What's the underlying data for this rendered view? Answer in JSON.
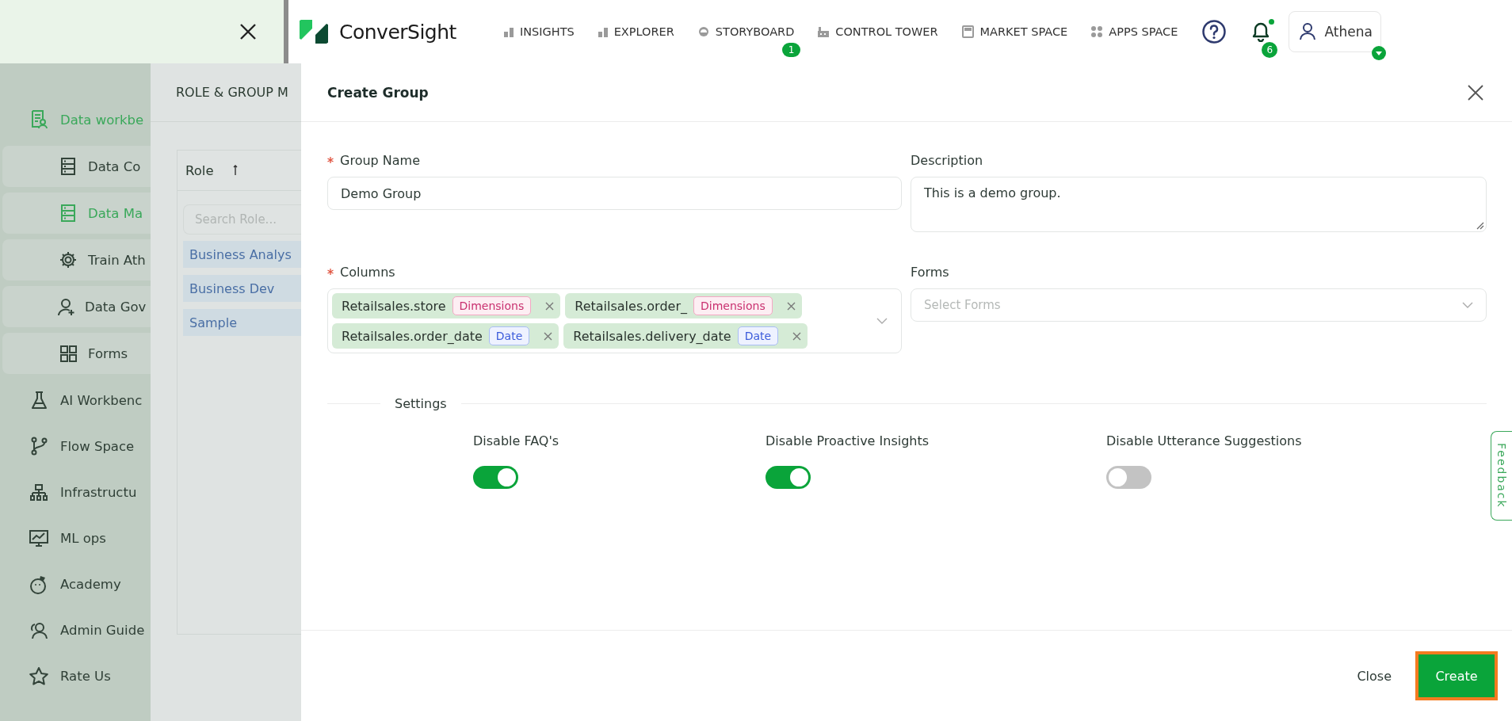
{
  "topbar": {
    "logo": "ConverSight",
    "nav": [
      {
        "label": "INSIGHTS",
        "kind": "bars"
      },
      {
        "label": "EXPLORER",
        "kind": "bars"
      },
      {
        "label": "STORYBOARD",
        "kind": "gauge",
        "badge": "1"
      },
      {
        "label": "CONTROL TOWER",
        "kind": "tower"
      },
      {
        "label": "MARKET SPACE",
        "kind": "store"
      },
      {
        "label": "APPS SPACE",
        "kind": "dots"
      }
    ],
    "notifications": {
      "count": "6",
      "unread": true
    },
    "user": {
      "name": "Athena"
    }
  },
  "sidebar": {
    "items": [
      {
        "label": "Data workbe",
        "kind": "doc",
        "active": true,
        "children": [
          {
            "label": "Data Co",
            "kind": "db",
            "active": false
          },
          {
            "label": "Data Ma",
            "kind": "db",
            "active": true
          },
          {
            "label": "Train Ath",
            "kind": "gear",
            "active": false
          },
          {
            "label": "Data Gov",
            "kind": "user-plus",
            "active": false
          },
          {
            "label": "Forms",
            "kind": "grid",
            "active": false
          }
        ]
      },
      {
        "label": "AI Workbenc",
        "kind": "flask",
        "active": false
      },
      {
        "label": "Flow Space",
        "kind": "branch",
        "active": false
      },
      {
        "label": "Infrastructu",
        "kind": "tree",
        "active": false
      },
      {
        "label": "ML ops",
        "kind": "chart",
        "active": false
      },
      {
        "label": "Academy",
        "kind": "face",
        "active": false
      },
      {
        "label": "Admin Guide",
        "kind": "users",
        "active": false
      },
      {
        "label": "Rate Us",
        "kind": "star",
        "active": false
      }
    ]
  },
  "role_panel": {
    "title": "ROLE & GROUP M",
    "column": "Role",
    "search": {
      "placeholder": "Search Role..."
    },
    "rows": [
      "Business Analys",
      "Business Dev",
      "Sample"
    ]
  },
  "modal": {
    "title": "Create Group",
    "group_name": {
      "label": "Group Name",
      "required": true,
      "value": "Demo Group"
    },
    "description": {
      "label": "Description",
      "required": false,
      "value": "This is a demo group."
    },
    "columns": {
      "label": "Columns",
      "required": true,
      "tags": [
        {
          "name": "Retailsales.store",
          "type": "Dimensions",
          "kind": "dimension"
        },
        {
          "name": "Retailsales.order_",
          "type": "Dimensions",
          "kind": "dimension"
        },
        {
          "name": "Retailsales.order_date",
          "type": "Date",
          "kind": "date"
        },
        {
          "name": "Retailsales.delivery_date",
          "type": "Date",
          "kind": "date"
        }
      ]
    },
    "forms": {
      "label": "Forms",
      "required": false,
      "placeholder": "Select Forms"
    },
    "settings": {
      "title": "Settings",
      "toggles": [
        {
          "label": "Disable FAQ's",
          "on": true
        },
        {
          "label": "Disable Proactive Insights",
          "on": true
        },
        {
          "label": "Disable Utterance Suggestions",
          "on": false
        }
      ]
    },
    "buttons": {
      "close": "Close",
      "create": "Create"
    }
  },
  "feedback": "Feedback"
}
